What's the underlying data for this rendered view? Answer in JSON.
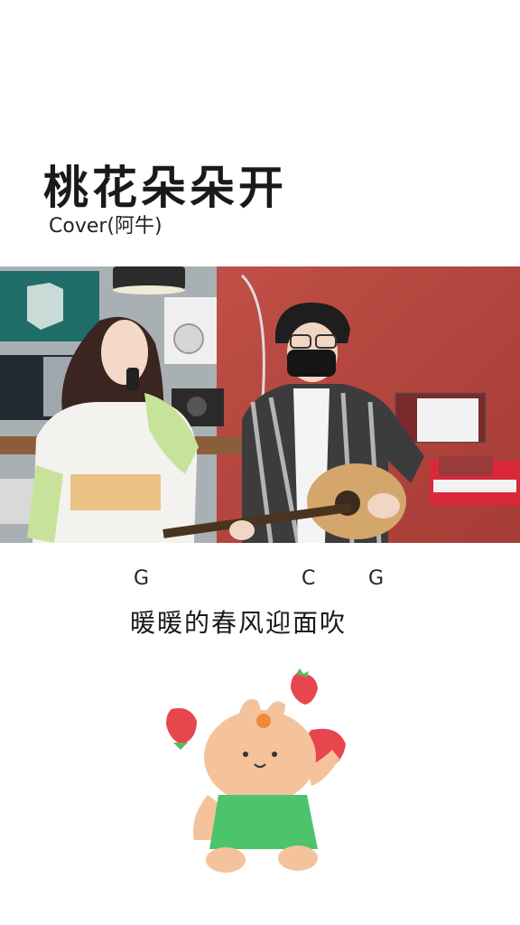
{
  "header": {
    "title": "桃花朵朵开",
    "subtitle": "Cover(阿牛)"
  },
  "lyrics": {
    "chords": [
      "G",
      "C",
      "G"
    ],
    "line": "暖暖的春风迎面吹"
  },
  "colors": {
    "wall_red": "#b8463f",
    "studio_gray": "#9ea7ac",
    "dress_green": "#4cc46b",
    "bunny_peach": "#f4c39b",
    "strawberry_red": "#e8464f",
    "keyboard_red": "#d8283a"
  }
}
